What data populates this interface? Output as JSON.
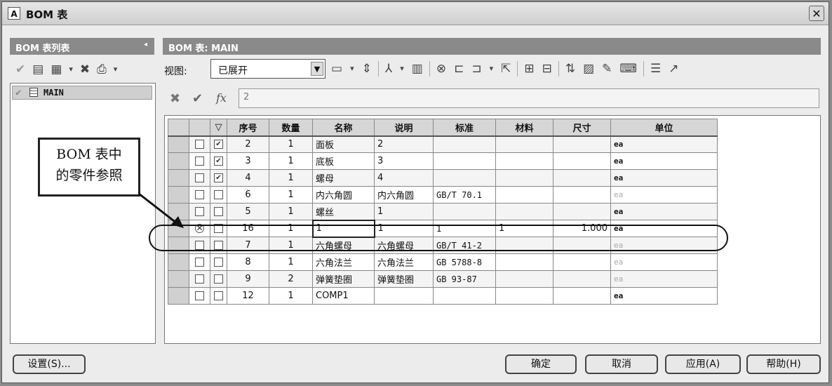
{
  "window": {
    "title": "BOM 表",
    "app_icon": "A",
    "close_glyph": "✕"
  },
  "left_panel": {
    "header": "BOM 表列表",
    "collapse_glyph": "◂",
    "list_items": [
      {
        "label": "MAIN"
      }
    ]
  },
  "right_panel": {
    "header": "BOM 表: MAIN",
    "view_label": "视图:",
    "view_value": "已展开",
    "formula_value": "2"
  },
  "table": {
    "columns": [
      "序号",
      "数量",
      "名称",
      "说明",
      "标准",
      "材料",
      "尺寸",
      "单位"
    ],
    "rows": [
      {
        "id": "2",
        "qty": "1",
        "name": "面板",
        "desc": "2",
        "std": "",
        "mat": "",
        "size": "",
        "unit": "ea",
        "checked": true,
        "unit_grey": false,
        "status": ""
      },
      {
        "id": "3",
        "qty": "1",
        "name": "底板",
        "desc": "3",
        "std": "",
        "mat": "",
        "size": "",
        "unit": "ea",
        "checked": true,
        "unit_grey": false,
        "status": ""
      },
      {
        "id": "4",
        "qty": "1",
        "name": "螺母",
        "desc": "4",
        "std": "",
        "mat": "",
        "size": "",
        "unit": "ea",
        "checked": true,
        "unit_grey": false,
        "status": ""
      },
      {
        "id": "6",
        "qty": "1",
        "name": "内六角圆",
        "desc": "内六角圆",
        "std": "GB/T 70.1",
        "mat": "",
        "size": "",
        "unit": "ea",
        "checked": false,
        "unit_grey": true,
        "status": ""
      },
      {
        "id": "5",
        "qty": "1",
        "name": "螺丝",
        "desc": "1",
        "std": "",
        "mat": "",
        "size": "",
        "unit": "ea",
        "checked": false,
        "unit_grey": false,
        "status": ""
      },
      {
        "id": "16",
        "qty": "1",
        "name": "1",
        "desc": "1",
        "std": "1",
        "mat": "1",
        "size": "1.000",
        "unit": "ea",
        "checked": false,
        "unit_grey": false,
        "status": "x"
      },
      {
        "id": "7",
        "qty": "1",
        "name": "六角螺母",
        "desc": "六角螺母",
        "std": "GB/T 41-2",
        "mat": "",
        "size": "",
        "unit": "ea",
        "checked": false,
        "unit_grey": true,
        "status": ""
      },
      {
        "id": "8",
        "qty": "1",
        "name": "六角法兰",
        "desc": "六角法兰",
        "std": "GB 5788-8",
        "mat": "",
        "size": "",
        "unit": "ea",
        "checked": false,
        "unit_grey": true,
        "status": ""
      },
      {
        "id": "9",
        "qty": "2",
        "name": "弹簧垫圈",
        "desc": "弹簧垫圈",
        "std": "GB 93-87",
        "mat": "",
        "size": "",
        "unit": "ea",
        "checked": false,
        "unit_grey": true,
        "status": ""
      },
      {
        "id": "12",
        "qty": "1",
        "name": "COMP1",
        "desc": "",
        "std": "",
        "mat": "",
        "size": "",
        "unit": "ea",
        "checked": false,
        "unit_grey": false,
        "status": ""
      }
    ]
  },
  "callout": {
    "line1": "BOM 表中",
    "line2": "的零件参照"
  },
  "buttons": {
    "settings": "设置(S)...",
    "ok": "确定",
    "cancel": "取消",
    "apply": "应用(A)",
    "help": "帮助(H)"
  }
}
